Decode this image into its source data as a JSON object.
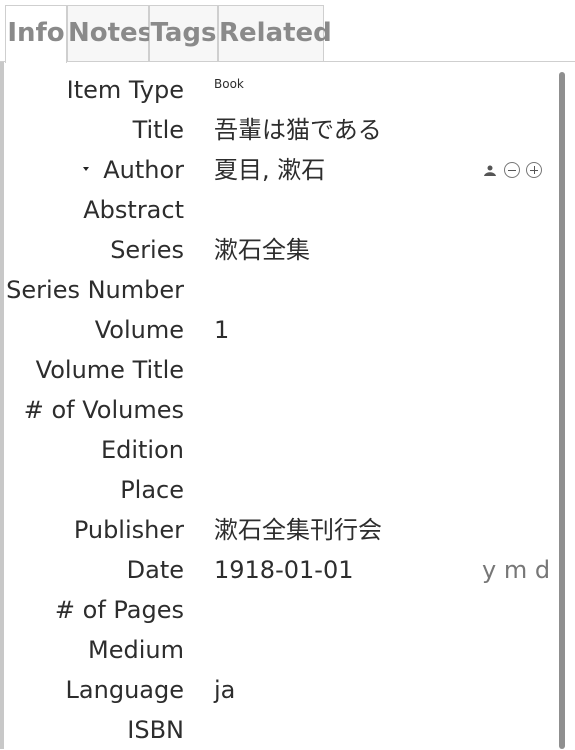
{
  "tabs": [
    {
      "label": "Info",
      "active": true
    },
    {
      "label": "Notes",
      "active": false
    },
    {
      "label": "Tags",
      "active": false
    },
    {
      "label": "Related",
      "active": false
    }
  ],
  "fields": {
    "item_type": {
      "label": "Item Type",
      "value": "Book"
    },
    "title": {
      "label": "Title",
      "value": "吾輩は猫である"
    },
    "author": {
      "label": "Author",
      "value": "夏目, 漱石"
    },
    "abstract": {
      "label": "Abstract",
      "value": ""
    },
    "series": {
      "label": "Series",
      "value": "漱石全集"
    },
    "series_number": {
      "label": "Series Number",
      "value": ""
    },
    "volume": {
      "label": "Volume",
      "value": "1"
    },
    "volume_title": {
      "label": "Volume Title",
      "value": ""
    },
    "num_volumes": {
      "label": "# of Volumes",
      "value": ""
    },
    "edition": {
      "label": "Edition",
      "value": ""
    },
    "place": {
      "label": "Place",
      "value": ""
    },
    "publisher": {
      "label": "Publisher",
      "value": "漱石全集刊行会"
    },
    "date": {
      "label": "Date",
      "value": "1918-01-01",
      "format": "y m d"
    },
    "num_pages": {
      "label": "# of Pages",
      "value": ""
    },
    "medium": {
      "label": "Medium",
      "value": ""
    },
    "language": {
      "label": "Language",
      "value": "ja"
    },
    "isbn": {
      "label": "ISBN",
      "value": ""
    }
  },
  "icons": {
    "creator_type_toggle": "person-silhouette-icon",
    "remove_creator": "minus-circle-icon",
    "add_creator": "plus-circle-icon",
    "creator_menu": "dropdown-arrow-icon"
  }
}
